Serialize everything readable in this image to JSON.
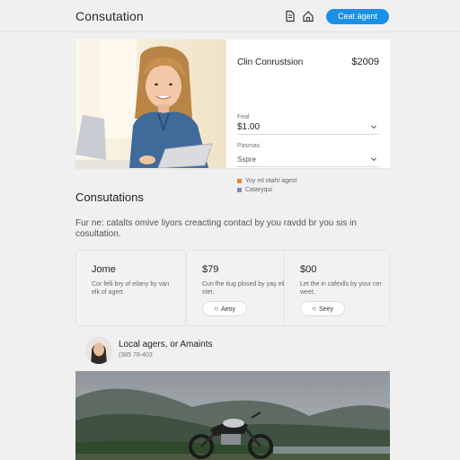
{
  "header": {
    "title": "Consutation",
    "icons": [
      "document-icon",
      "home-icon"
    ],
    "cta_label": "Ceat ägent",
    "accent": "#1a91e8"
  },
  "hero": {
    "form": {
      "title": "Clin Conrustsion",
      "price": "$2009",
      "fee_label": "Feal",
      "fee_value": "$1.00",
      "pricing_label": "Pasmas",
      "select_value": "Sspre",
      "check1": "Yoy ml otaht agest",
      "check2": "Cataryqui"
    }
  },
  "section": {
    "title": "Consutations",
    "description": "Fur ne: catalts omive liyors creacting contacl by you ravdd br you sis in cosultation."
  },
  "cards": [
    {
      "title": "Jome",
      "description": "Cor felli bry of eilany by varı elk of agert.",
      "button": null
    },
    {
      "title": "$79",
      "description": "Cun fhe tiug plosed by yaş eilz stet.",
      "button": "Aeoy"
    },
    {
      "title": "$00",
      "description": "Let the in cafexlls by your cer weet.",
      "button": "Seey"
    }
  ],
  "agent": {
    "name": "Local agers, or Amaints",
    "phone": "(385 78-403"
  }
}
